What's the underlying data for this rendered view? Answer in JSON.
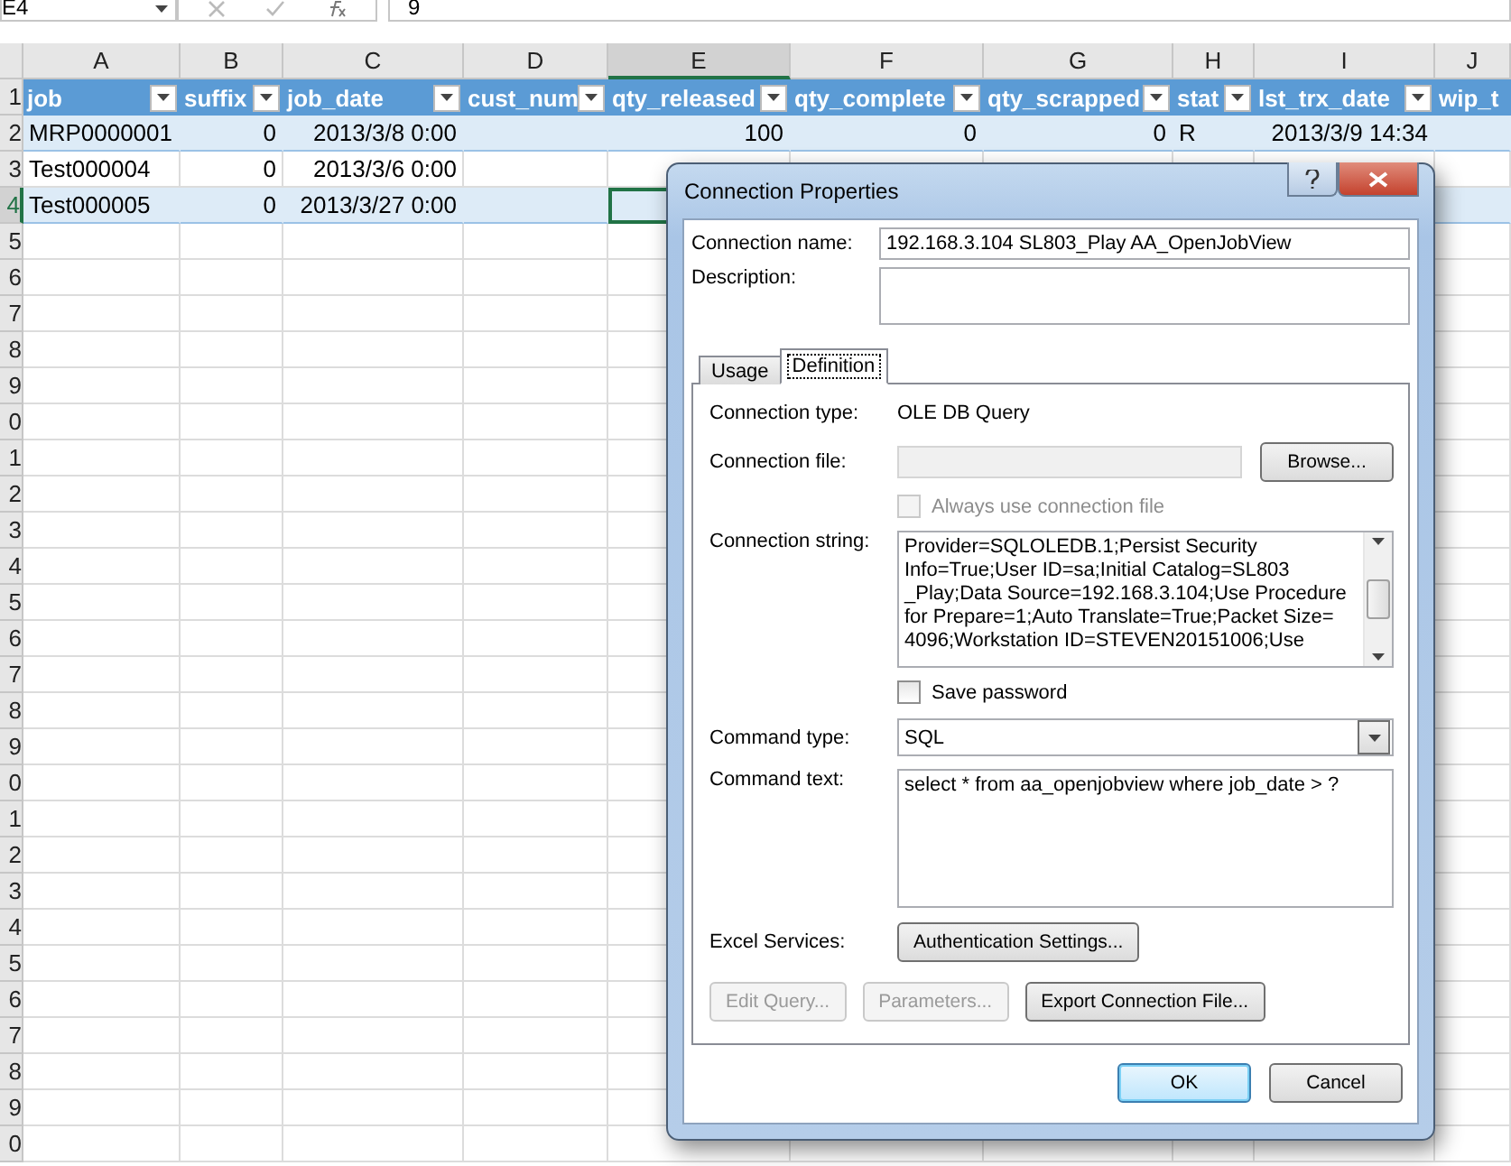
{
  "formula_bar": {
    "name_box": "E4",
    "formula": "9"
  },
  "sheet": {
    "columns": [
      {
        "letter": "A",
        "selected": false
      },
      {
        "letter": "B",
        "selected": false
      },
      {
        "letter": "C",
        "selected": false
      },
      {
        "letter": "D",
        "selected": false
      },
      {
        "letter": "E",
        "selected": true
      },
      {
        "letter": "F",
        "selected": false
      },
      {
        "letter": "G",
        "selected": false
      },
      {
        "letter": "H",
        "selected": false
      },
      {
        "letter": "I",
        "selected": false
      },
      {
        "letter": "J",
        "selected": false
      }
    ],
    "header_row": {
      "number": "1",
      "labels": [
        "job",
        "suffix",
        "job_date",
        "cust_num",
        "qty_released",
        "qty_complete",
        "qty_scrapped",
        "stat",
        "lst_trx_date",
        "wip_t"
      ]
    },
    "rows": [
      {
        "number": "2",
        "selected": false,
        "banded": true,
        "cells": [
          {
            "text": "MRP0000001",
            "kind": "text"
          },
          {
            "text": "0",
            "kind": "number"
          },
          {
            "text": "2013/3/8 0:00",
            "kind": "number"
          },
          {
            "text": "",
            "kind": "text"
          },
          {
            "text": "100",
            "kind": "number"
          },
          {
            "text": "0",
            "kind": "number"
          },
          {
            "text": "0",
            "kind": "number"
          },
          {
            "text": "R",
            "kind": "text"
          },
          {
            "text": "2013/3/9 14:34",
            "kind": "number"
          }
        ]
      },
      {
        "number": "3",
        "selected": false,
        "banded": false,
        "cells": [
          {
            "text": "Test000004",
            "kind": "text"
          },
          {
            "text": "0",
            "kind": "number"
          },
          {
            "text": "2013/3/6 0:00",
            "kind": "number"
          }
        ]
      },
      {
        "number": "4",
        "selected": true,
        "banded": true,
        "cells": [
          {
            "text": "Test000005",
            "kind": "text"
          },
          {
            "text": "0",
            "kind": "number"
          },
          {
            "text": "2013/3/27 0:00",
            "kind": "number"
          }
        ]
      },
      {
        "number": "5",
        "selected": false,
        "banded": false,
        "cells": []
      },
      {
        "number": "6",
        "selected": false,
        "banded": false,
        "cells": []
      },
      {
        "number": "7",
        "selected": false,
        "banded": false,
        "cells": []
      },
      {
        "number": "8",
        "selected": false,
        "banded": false,
        "cells": []
      },
      {
        "number": "9",
        "selected": false,
        "banded": false,
        "cells": []
      },
      {
        "number": "0",
        "selected": false,
        "banded": false,
        "cells": []
      },
      {
        "number": "1",
        "selected": false,
        "banded": false,
        "cells": []
      },
      {
        "number": "2",
        "selected": false,
        "banded": false,
        "cells": []
      },
      {
        "number": "3",
        "selected": false,
        "banded": false,
        "cells": []
      },
      {
        "number": "4",
        "selected": false,
        "banded": false,
        "cells": []
      },
      {
        "number": "5",
        "selected": false,
        "banded": false,
        "cells": []
      },
      {
        "number": "6",
        "selected": false,
        "banded": false,
        "cells": []
      },
      {
        "number": "7",
        "selected": false,
        "banded": false,
        "cells": []
      },
      {
        "number": "8",
        "selected": false,
        "banded": false,
        "cells": []
      },
      {
        "number": "9",
        "selected": false,
        "banded": false,
        "cells": []
      },
      {
        "number": "0",
        "selected": false,
        "banded": false,
        "cells": []
      },
      {
        "number": "1",
        "selected": false,
        "banded": false,
        "cells": []
      },
      {
        "number": "2",
        "selected": false,
        "banded": false,
        "cells": []
      },
      {
        "number": "3",
        "selected": false,
        "banded": false,
        "cells": []
      },
      {
        "number": "4",
        "selected": false,
        "banded": false,
        "cells": []
      },
      {
        "number": "5",
        "selected": false,
        "banded": false,
        "cells": []
      },
      {
        "number": "6",
        "selected": false,
        "banded": false,
        "cells": []
      },
      {
        "number": "7",
        "selected": false,
        "banded": false,
        "cells": []
      },
      {
        "number": "8",
        "selected": false,
        "banded": false,
        "cells": []
      },
      {
        "number": "9",
        "selected": false,
        "banded": false,
        "cells": []
      },
      {
        "number": "0",
        "selected": false,
        "banded": false,
        "cells": []
      }
    ]
  },
  "dialog": {
    "title": "Connection Properties",
    "connection_name": {
      "label": "Connection name:",
      "value": "192.168.3.104 SL803_Play AA_OpenJobView"
    },
    "description": {
      "label": "Description:"
    },
    "tabs": [
      {
        "label": "Usage",
        "selected": false
      },
      {
        "label": "Definition",
        "selected": true
      }
    ],
    "connection_type": {
      "label": "Connection type:",
      "value": "OLE DB Query"
    },
    "connection_file": {
      "label": "Connection file:",
      "disabled": true,
      "button": "Browse..."
    },
    "always_use": {
      "label": "Always use connection file",
      "checked": false,
      "disabled": true
    },
    "connection_string": {
      "label": "Connection string:",
      "lines": [
        "Provider=SQLOLEDB.1;Persist Security",
        "Info=True;User ID=sa;Initial Catalog=SL803",
        "_Play;Data Source=192.168.3.104;Use Procedure",
        "for Prepare=1;Auto Translate=True;Packet Size=",
        "4096;Workstation ID=STEVEN20151006;Use"
      ]
    },
    "save_password": {
      "label": "Save password",
      "checked": false,
      "disabled": false
    },
    "command_type": {
      "label": "Command type:",
      "value": "SQL"
    },
    "command_text": {
      "label": "Command text:",
      "value": "select * from aa_openjobview where job_date > ?"
    },
    "excel_services": {
      "label": "Excel Services:",
      "button": "Authentication Settings..."
    },
    "actions": [
      {
        "label": "Edit Query...",
        "disabled": true
      },
      {
        "label": "Parameters...",
        "disabled": true
      },
      {
        "label": "Export Connection File...",
        "disabled": false
      }
    ],
    "footer": [
      {
        "label": "OK",
        "default": true
      },
      {
        "label": "Cancel",
        "default": false
      }
    ]
  }
}
